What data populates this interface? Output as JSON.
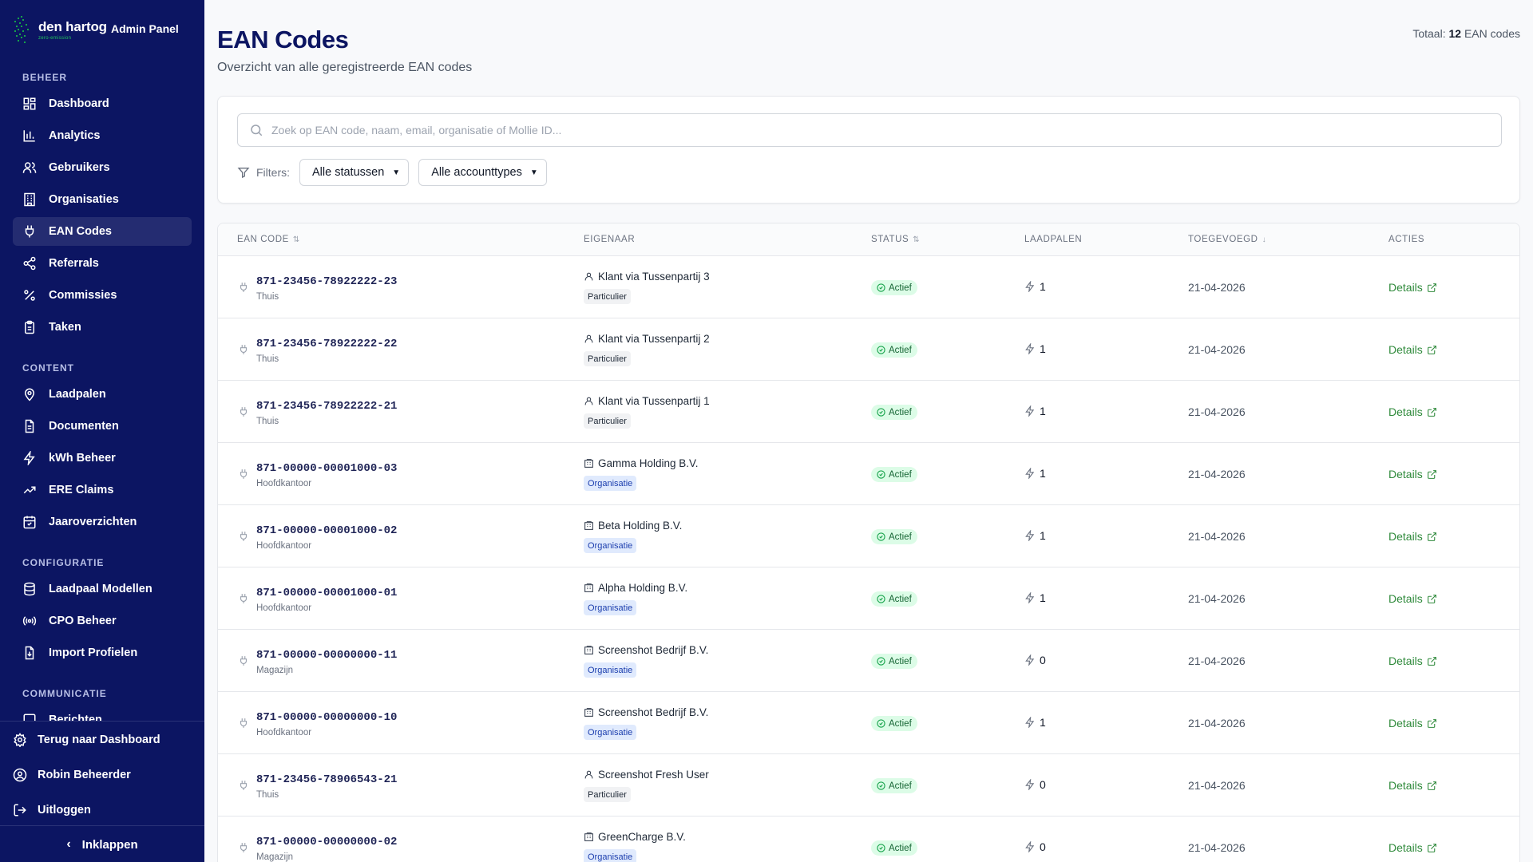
{
  "brand": {
    "name": "den hartog",
    "tagline": "zero-emission",
    "panel": "Admin Panel"
  },
  "sidebar": {
    "sections": [
      {
        "title": "BEHEER",
        "items": [
          {
            "label": "Dashboard",
            "icon": "dashboard-icon"
          },
          {
            "label": "Analytics",
            "icon": "bar-chart-icon"
          },
          {
            "label": "Gebruikers",
            "icon": "users-icon"
          },
          {
            "label": "Organisaties",
            "icon": "building-icon"
          },
          {
            "label": "EAN Codes",
            "icon": "plug-icon",
            "active": true
          },
          {
            "label": "Referrals",
            "icon": "share-icon"
          },
          {
            "label": "Commissies",
            "icon": "percent-icon"
          },
          {
            "label": "Taken",
            "icon": "clipboard-icon"
          }
        ]
      },
      {
        "title": "CONTENT",
        "items": [
          {
            "label": "Laadpalen",
            "icon": "map-pin-icon"
          },
          {
            "label": "Documenten",
            "icon": "document-icon"
          },
          {
            "label": "kWh Beheer",
            "icon": "lightning-icon"
          },
          {
            "label": "ERE Claims",
            "icon": "trending-up-icon"
          },
          {
            "label": "Jaaroverzichten",
            "icon": "calendar-icon"
          }
        ]
      },
      {
        "title": "CONFIGURATIE",
        "items": [
          {
            "label": "Laadpaal Modellen",
            "icon": "database-icon"
          },
          {
            "label": "CPO Beheer",
            "icon": "broadcast-icon"
          },
          {
            "label": "Import Profielen",
            "icon": "import-icon"
          }
        ]
      },
      {
        "title": "COMMUNICATIE",
        "items": [
          {
            "label": "Berichten",
            "icon": "message-icon"
          }
        ]
      }
    ],
    "bottom": {
      "back": "Terug naar Dashboard",
      "user": "Robin Beheerder",
      "logout": "Uitloggen",
      "collapse": "Inklappen"
    }
  },
  "page": {
    "title": "EAN Codes",
    "subtitle": "Overzicht van alle geregistreerde EAN codes",
    "total_prefix": "Totaal:",
    "total_count": "12",
    "total_suffix": "EAN codes"
  },
  "search": {
    "placeholder": "Zoek op EAN code, naam, email, organisatie of Mollie ID..."
  },
  "filters": {
    "label": "Filters:",
    "status_selected": "Alle statussen",
    "type_selected": "Alle accounttypes"
  },
  "table": {
    "columns": [
      "EAN CODE",
      "EIGENAAR",
      "STATUS",
      "LAADPALEN",
      "TOEGEVOEGD",
      "ACTIES"
    ],
    "details_label": "Details",
    "rows": [
      {
        "ean": "871-23456-78922222-23",
        "location": "Thuis",
        "owner": "Klant via Tussenpartij 3",
        "owner_type": "person",
        "account": "Particulier",
        "status": "Actief",
        "laadpalen": "1",
        "date": "21-04-2026"
      },
      {
        "ean": "871-23456-78922222-22",
        "location": "Thuis",
        "owner": "Klant via Tussenpartij 2",
        "owner_type": "person",
        "account": "Particulier",
        "status": "Actief",
        "laadpalen": "1",
        "date": "21-04-2026"
      },
      {
        "ean": "871-23456-78922222-21",
        "location": "Thuis",
        "owner": "Klant via Tussenpartij 1",
        "owner_type": "person",
        "account": "Particulier",
        "status": "Actief",
        "laadpalen": "1",
        "date": "21-04-2026"
      },
      {
        "ean": "871-00000-00001000-03",
        "location": "Hoofdkantoor",
        "owner": "Gamma Holding B.V.",
        "owner_type": "org",
        "account": "Organisatie",
        "status": "Actief",
        "laadpalen": "1",
        "date": "21-04-2026"
      },
      {
        "ean": "871-00000-00001000-02",
        "location": "Hoofdkantoor",
        "owner": "Beta Holding B.V.",
        "owner_type": "org",
        "account": "Organisatie",
        "status": "Actief",
        "laadpalen": "1",
        "date": "21-04-2026"
      },
      {
        "ean": "871-00000-00001000-01",
        "location": "Hoofdkantoor",
        "owner": "Alpha Holding B.V.",
        "owner_type": "org",
        "account": "Organisatie",
        "status": "Actief",
        "laadpalen": "1",
        "date": "21-04-2026"
      },
      {
        "ean": "871-00000-00000000-11",
        "location": "Magazijn",
        "owner": "Screenshot Bedrijf B.V.",
        "owner_type": "org",
        "account": "Organisatie",
        "status": "Actief",
        "laadpalen": "0",
        "date": "21-04-2026"
      },
      {
        "ean": "871-00000-00000000-10",
        "location": "Hoofdkantoor",
        "owner": "Screenshot Bedrijf B.V.",
        "owner_type": "org",
        "account": "Organisatie",
        "status": "Actief",
        "laadpalen": "1",
        "date": "21-04-2026"
      },
      {
        "ean": "871-23456-78906543-21",
        "location": "Thuis",
        "owner": "Screenshot Fresh User",
        "owner_type": "person",
        "account": "Particulier",
        "status": "Actief",
        "laadpalen": "0",
        "date": "21-04-2026"
      },
      {
        "ean": "871-00000-00000000-02",
        "location": "Magazijn",
        "owner": "GreenCharge B.V.",
        "owner_type": "org",
        "account": "Organisatie",
        "status": "Actief",
        "laadpalen": "0",
        "date": "21-04-2026"
      }
    ]
  }
}
